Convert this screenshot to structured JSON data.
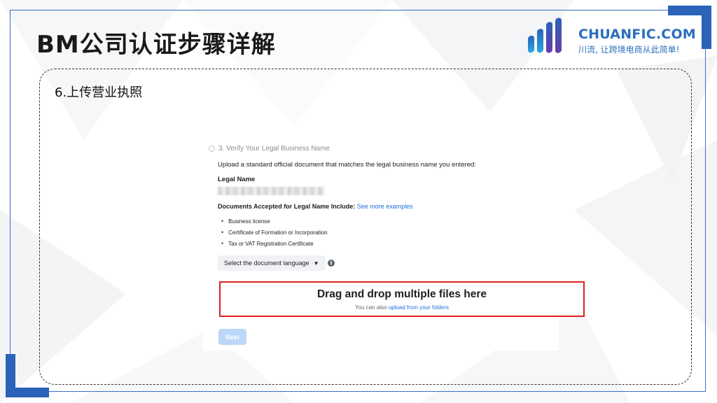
{
  "slide": {
    "title": "BM公司认证步骤详解",
    "step_label": "6.上传营业执照"
  },
  "logo": {
    "name": "CHUANFIC.COM",
    "slogan": "川流, 让跨境电商从此简单!",
    "brand_color": "#2a6fbd"
  },
  "screenshot": {
    "step_header": "3. Verify Your Legal Business Name",
    "instruction": "Upload a standard official document that matches the legal business name you entered:",
    "legal_name_label": "Legal Name",
    "documents_label": "Documents Accepted for Legal Name Include:",
    "documents_link": "See more examples",
    "documents": [
      "Business license",
      "Certificate of Formation or Incorporation",
      "Tax or VAT Registration Certificate"
    ],
    "language_select": "Select the document language",
    "info_icon": "i",
    "dropzone": {
      "title": "Drag and drop multiple files here",
      "sub_prefix": "You can also",
      "sub_link": "upload from your folders"
    },
    "next_label": "Next"
  },
  "colors": {
    "frame": "#3b6fc4",
    "highlight": "#e02020",
    "link": "#216fdb"
  }
}
